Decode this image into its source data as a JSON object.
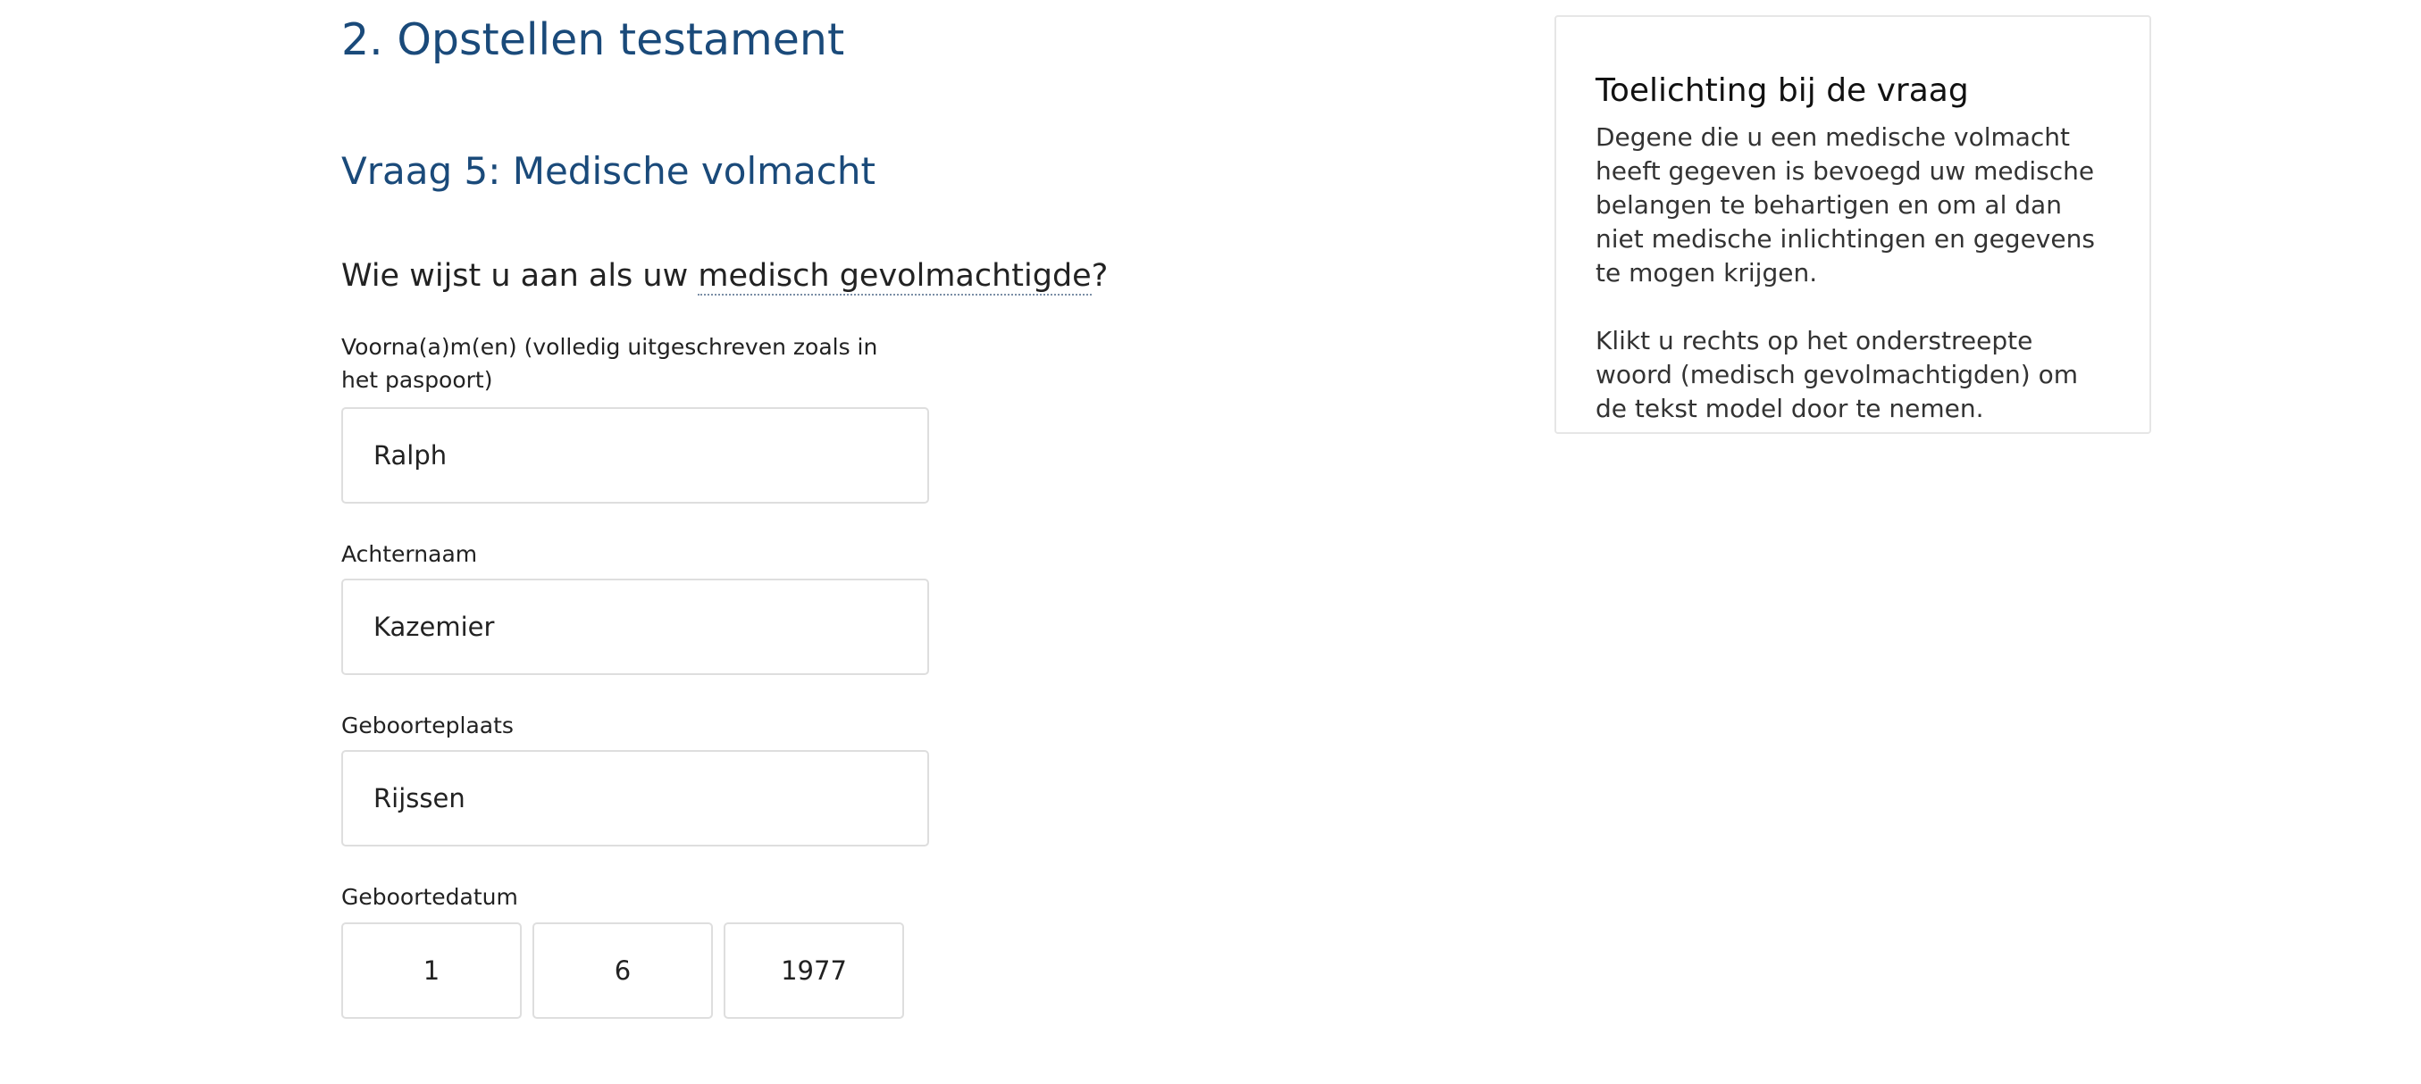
{
  "form": {
    "section_title": "2. Opstellen testament",
    "question_title": "Vraag 5: Medische volmacht",
    "question": {
      "prefix": "Wie wijst u aan als uw ",
      "term": "medisch gevolmachtigde",
      "suffix": "?"
    },
    "fields": {
      "first_names": {
        "label": "Voorna(a)m(en) (volledig uitgeschreven zoals in het paspoort)",
        "value": "Ralph"
      },
      "last_name": {
        "label": "Achternaam",
        "value": "Kazemier"
      },
      "birthplace": {
        "label": "Geboorteplaats",
        "value": "Rijssen"
      },
      "birthdate": {
        "label": "Geboortedatum",
        "day": "1",
        "month": "6",
        "year": "1977"
      }
    }
  },
  "info_panel": {
    "title": "Toelichting bij de vraag",
    "paragraphs": [
      "Degene die u een medische volmacht heeft gegeven is bevoegd uw medische belangen te behartigen en om al dan niet medische inlichtingen en gegevens te mogen krijgen.",
      "Klikt u rechts op het onderstreepte woord (medisch gevolmachtigden) om de tekst model door te nemen."
    ]
  },
  "colors": {
    "heading": "#1a4a7a",
    "text": "#222222",
    "border": "#dedede"
  }
}
